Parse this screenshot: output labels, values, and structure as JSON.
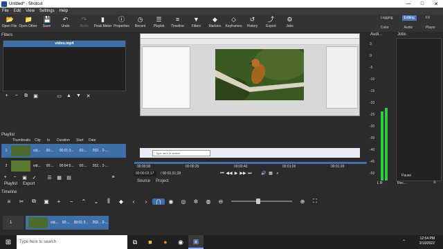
{
  "window": {
    "title": "Untitled* - Shotcut",
    "controls": [
      "—",
      "□",
      "✕"
    ]
  },
  "menu": [
    "File",
    "Edit",
    "View",
    "Settings",
    "Help"
  ],
  "toolbar": {
    "buttons": [
      {
        "label": "Open File",
        "icon": "folder-open-icon",
        "glyph": "📂"
      },
      {
        "label": "Open Other",
        "icon": "folder-plus-icon",
        "glyph": "📁"
      },
      {
        "label": "Save",
        "icon": "save-icon",
        "glyph": "💾"
      },
      {
        "label": "Undo",
        "icon": "undo-icon",
        "glyph": "↶"
      },
      {
        "label": "Redo",
        "icon": "redo-icon",
        "glyph": "↷"
      },
      {
        "label": "Peak Meter",
        "icon": "meter-icon",
        "glyph": "▮"
      },
      {
        "label": "Properties",
        "icon": "info-icon",
        "glyph": "ⓘ"
      },
      {
        "label": "Recent",
        "icon": "clock-icon",
        "glyph": "◷"
      },
      {
        "label": "Playlist",
        "icon": "list-icon",
        "glyph": "☰"
      },
      {
        "label": "Timeline",
        "icon": "timeline-icon",
        "glyph": "≡"
      },
      {
        "label": "Filters",
        "icon": "filter-icon",
        "glyph": "▼"
      },
      {
        "label": "Markers",
        "icon": "marker-icon",
        "glyph": "◆"
      },
      {
        "label": "Keyframes",
        "icon": "keyframe-icon",
        "glyph": "◇"
      },
      {
        "label": "History",
        "icon": "history-icon",
        "glyph": "↺"
      },
      {
        "label": "Export",
        "icon": "export-icon",
        "glyph": "⤴"
      },
      {
        "label": "Jobs",
        "icon": "jobs-icon",
        "glyph": "⚙"
      }
    ],
    "layouts": [
      {
        "label": "Logging",
        "active": false
      },
      {
        "label": "Editing",
        "active": true
      },
      {
        "label": "FX",
        "active": false
      },
      {
        "label": "Color",
        "active": false
      },
      {
        "label": "Audio",
        "active": false
      },
      {
        "label": "Player",
        "active": false
      }
    ]
  },
  "filters": {
    "title": "Filters",
    "selected_clip": "video.mp4"
  },
  "player": {
    "inner_search": "Type here to search",
    "ticks": [
      "00:00:00",
      "00:00:20",
      "00:00:40",
      "00:01:00",
      "00:01:20"
    ],
    "timecode_current": "00:00:02;17",
    "timecode_total": "/ 00:01:31;28",
    "tabs": [
      "Source",
      "Project"
    ]
  },
  "audio": {
    "title": "Audi...",
    "scale": [
      "3",
      "0",
      "-5",
      "-10",
      "-15",
      "-20",
      "-25",
      "-30",
      "-35",
      "-40",
      "-45",
      "-50"
    ],
    "channels": "L R"
  },
  "jobs": {
    "title": "Jobs",
    "pause": "Pause",
    "rec_label": "Rec...",
    "menu_label": "≡"
  },
  "playlist": {
    "title": "Playlist",
    "columns": [
      "Thumbnails",
      "Clip",
      "In",
      "Duration",
      "Start",
      "Date"
    ],
    "rows": [
      {
        "num": "1",
        "clip": "vid...",
        "in": "00:...",
        "duration": "00:01:3...",
        "start": "00:...",
        "date": "202... 2-...",
        "selected": true
      },
      {
        "num": "2",
        "clip": "vid...",
        "in": "00:...",
        "duration": "00:04:5...",
        "start": "00:...",
        "date": "202... 2-...",
        "selected": false
      }
    ],
    "tabs": [
      "Playlist",
      "Export"
    ]
  },
  "timeline": {
    "title": "Timeline",
    "track": "1",
    "clip": {
      "name": "vid...",
      "in": "00:...",
      "duration": "00:01:3...",
      "date": "202... 2-..."
    }
  },
  "taskbar": {
    "search_placeholder": "Type here to search",
    "time": "12:54 PM",
    "date": "2/10/2022"
  }
}
